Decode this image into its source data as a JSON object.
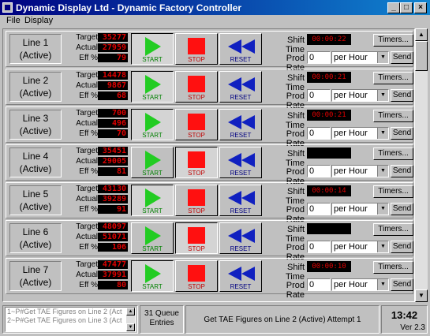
{
  "window": {
    "title": "Dynamic Display Ltd - Dynamic Factory Controller",
    "controls": [
      "_",
      "□",
      "×"
    ]
  },
  "menu": [
    "File",
    "Display"
  ],
  "labels": {
    "target": "Target",
    "actual": "Actual",
    "eff": "Eff %",
    "start": "START",
    "stop": "STOP",
    "reset": "RESET",
    "shift_time": "Shift Time",
    "prod_rate": "Prod Rate",
    "timers": "Timers...",
    "send": "Send"
  },
  "colors": {
    "start_icon": "#22cc22",
    "stop_icon": "#ff1010",
    "reset_icon": "#1020c0",
    "readout_text": "#e00000"
  },
  "lines": [
    {
      "name": "Line 1",
      "state": "(Active)",
      "target": "35277",
      "actual": "27959",
      "eff": "79",
      "shift_time": "00:00:22",
      "rate": "0",
      "unit": "per Hour",
      "pressed": "start"
    },
    {
      "name": "Line 2",
      "state": "(Active)",
      "target": "14478",
      "actual": "9867",
      "eff": "68",
      "shift_time": "00:00:21",
      "rate": "0",
      "unit": "per Hour",
      "pressed": "start"
    },
    {
      "name": "Line 3",
      "state": "(Active)",
      "target": "700",
      "actual": "496",
      "eff": "70",
      "shift_time": "00:00:21",
      "rate": "0",
      "unit": "per Hour",
      "pressed": "start"
    },
    {
      "name": "Line 4",
      "state": "(Active)",
      "target": "35451",
      "actual": "29005",
      "eff": "81",
      "shift_time": "",
      "rate": "0",
      "unit": "per Hour",
      "pressed": "stop"
    },
    {
      "name": "Line 5",
      "state": "(Active)",
      "target": "43130",
      "actual": "39289",
      "eff": "91",
      "shift_time": "00:00:14",
      "rate": "0",
      "unit": "per Hour",
      "pressed": "start"
    },
    {
      "name": "Line 6",
      "state": "(Active)",
      "target": "48097",
      "actual": "51071",
      "eff": "106",
      "shift_time": "",
      "rate": "0",
      "unit": "per Hour",
      "pressed": "stop"
    },
    {
      "name": "Line 7",
      "state": "(Active)",
      "target": "47477",
      "actual": "37991",
      "eff": "80",
      "shift_time": "00:00:10",
      "rate": "0",
      "unit": "per Hour",
      "pressed": "start"
    }
  ],
  "status_bar": {
    "queue_items": [
      "1~P#Get TAE Figures on Line 2 (Act",
      "2~P#Get TAE Figures on Line 3 (Act"
    ],
    "queue_count": "31 Queue Entries",
    "message": "Get TAE Figures on Line 2 (Active) Attempt 1",
    "clock": "13:42",
    "version": "Ver 2.3"
  }
}
